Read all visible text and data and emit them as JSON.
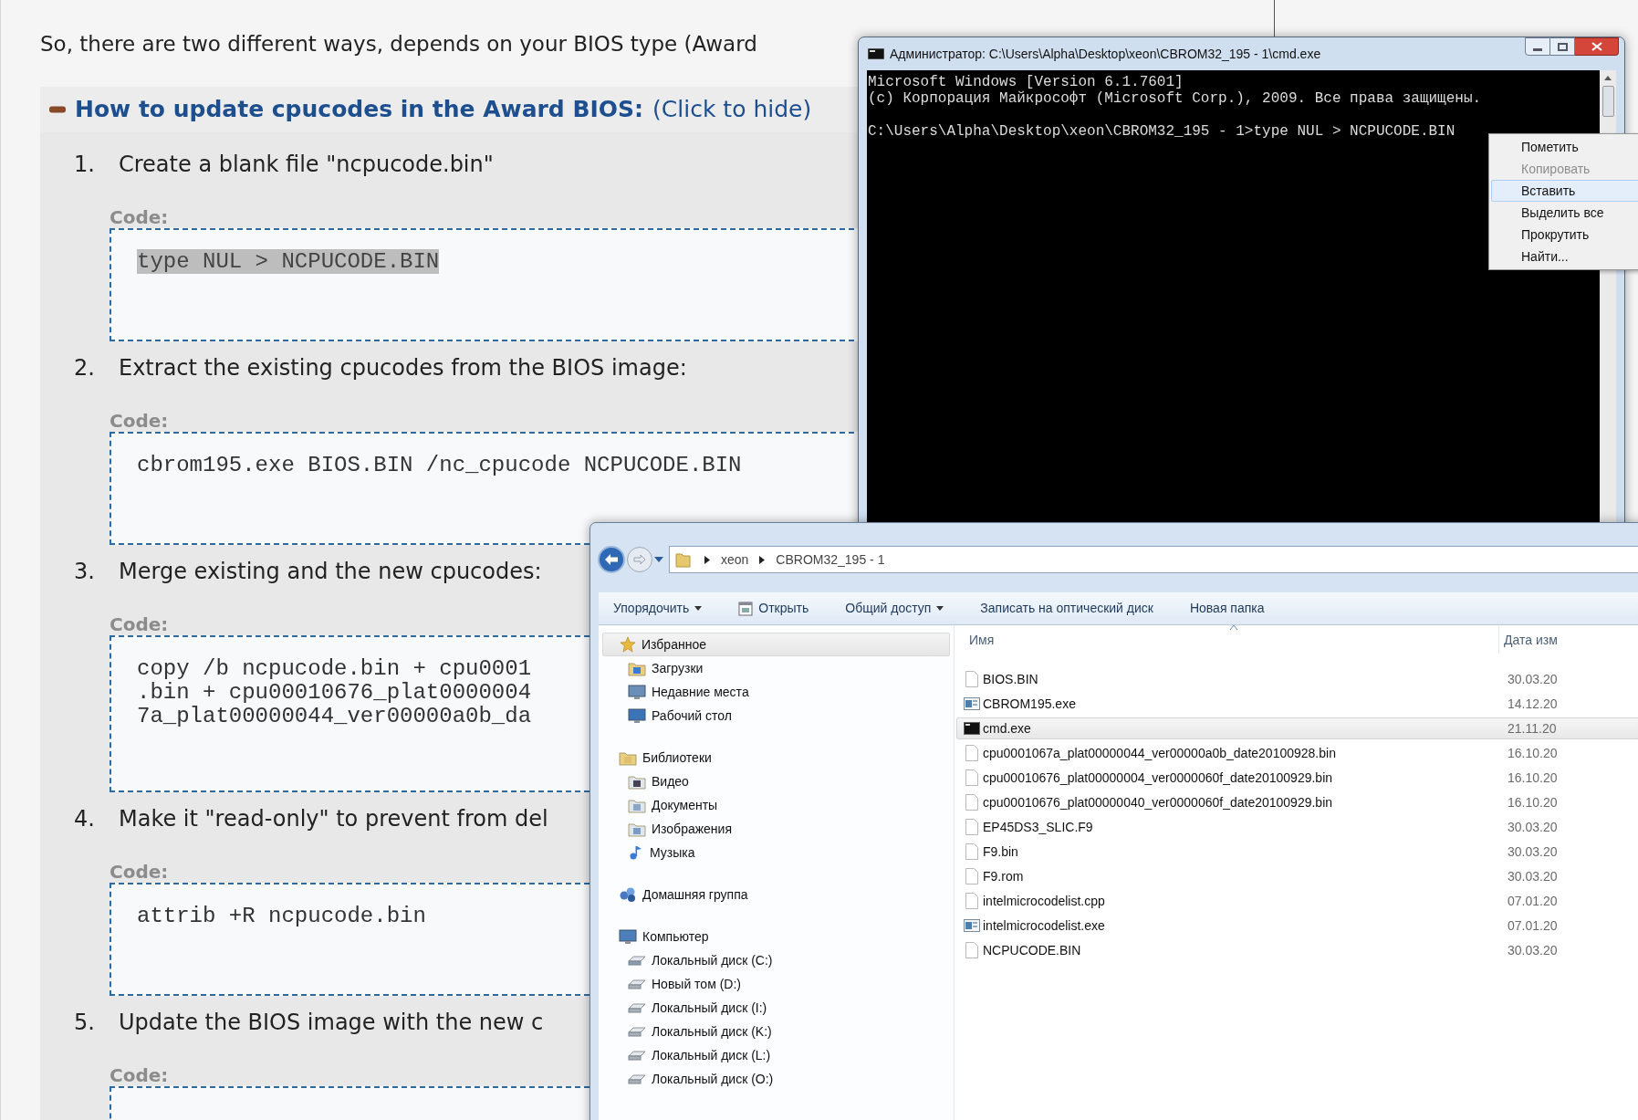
{
  "page": {
    "intro": "So, there are two different ways, depends on your BIOS type (Award",
    "section": {
      "expanded": true,
      "title": "How to update cpucodes in the Award BIOS:",
      "toggle": "(Click to hide)",
      "steps": [
        {
          "number": "1.",
          "text": "Create a blank file \"ncpucode.bin\"",
          "code_label": "Code:",
          "code_lines": [
            "type NUL > NCPUCODE.BIN"
          ],
          "code_selected": true
        },
        {
          "number": "2.",
          "text": "Extract the existing cpucodes from the BIOS image:",
          "code_label": "Code:",
          "code_lines": [
            "cbrom195.exe BIOS.BIN /nc_cpucode NCPUCODE.BIN"
          ]
        },
        {
          "number": "3.",
          "text": "Merge existing and the new cpucodes:",
          "code_label": "Code:",
          "code_lines": [
            "copy /b ncpucode.bin + cpu0001",
            ".bin + cpu00010676_plat0000004",
            "7a_plat00000044_ver00000a0b_da"
          ]
        },
        {
          "number": "4.",
          "text": "Make it \"read-only\" to prevent from del",
          "code_label": "Code:",
          "code_lines": [
            "attrib +R ncpucode.bin"
          ]
        },
        {
          "number": "5.",
          "text": "Update the BIOS image with the new c",
          "code_label": "Code:"
        }
      ]
    }
  },
  "console_window": {
    "title": "Администратор: C:\\Users\\Alpha\\Desktop\\xeon\\CBROM32_195 - 1\\cmd.exe",
    "lines": [
      "Microsoft Windows [Version 6.1.7601]",
      "(c) Корпорация Майкрософт (Microsoft Corp.), 2009. Все права защищены.",
      "C:\\Users\\Alpha\\Desktop\\xeon\\CBROM32_195 - 1>type NUL > NCPUCODE.BIN"
    ],
    "context_menu": [
      {
        "label": "Пометить",
        "disabled": false,
        "selected": false
      },
      {
        "label": "Копировать",
        "disabled": true,
        "selected": false
      },
      {
        "label": "Вставить",
        "disabled": false,
        "selected": true
      },
      {
        "label": "Выделить все",
        "disabled": false,
        "selected": false
      },
      {
        "label": "Прокрутить",
        "disabled": false,
        "selected": false
      },
      {
        "label": "Найти...",
        "disabled": false,
        "selected": false
      }
    ]
  },
  "explorer_window": {
    "breadcrumb": [
      "xeon",
      "CBROM32_195 - 1"
    ],
    "toolbar": [
      {
        "label": "Упорядочить",
        "kind": "menu"
      },
      {
        "label": "Открыть",
        "kind": "open"
      },
      {
        "label": "Общий доступ",
        "kind": "menu"
      },
      {
        "label": "Записать на оптический диск",
        "kind": "plain"
      },
      {
        "label": "Новая папка",
        "kind": "plain"
      }
    ],
    "sidebar": [
      {
        "label": "Избранное",
        "kind": "favorites",
        "selected": true,
        "children": [
          {
            "label": "Загрузки",
            "kind": "downloads",
            "selected": false
          },
          {
            "label": "Недавние места",
            "kind": "recent",
            "selected": false
          },
          {
            "label": "Рабочий стол",
            "kind": "desktop",
            "selected": false
          }
        ]
      },
      {
        "label": "Библиотеки",
        "kind": "libraries",
        "selected": false,
        "children": [
          {
            "label": "Видео",
            "kind": "video",
            "selected": false
          },
          {
            "label": "Документы",
            "kind": "documents",
            "selected": false
          },
          {
            "label": "Изображения",
            "kind": "pictures",
            "selected": false
          },
          {
            "label": "Музыка",
            "kind": "music",
            "selected": false
          }
        ]
      },
      {
        "label": "Домашняя группа",
        "kind": "homegroup",
        "selected": false
      },
      {
        "label": "Компьютер",
        "kind": "computer",
        "selected": false,
        "children": [
          {
            "label": "Локальный диск (C:)",
            "kind": "system_drive",
            "selected": false
          },
          {
            "label": "Новый том (D:)",
            "kind": "drive",
            "selected": false
          },
          {
            "label": "Локальный диск (I:)",
            "kind": "drive",
            "selected": false
          },
          {
            "label": "Локальный диск (K:)",
            "kind": "drive",
            "selected": false
          },
          {
            "label": "Локальный диск (L:)",
            "kind": "drive",
            "selected": false
          },
          {
            "label": "Локальный диск (O:)",
            "kind": "drive",
            "selected": false
          }
        ]
      }
    ],
    "columns": [
      "Имя",
      "Дата изм"
    ],
    "files": [
      {
        "name": "BIOS.BIN",
        "kind": "file",
        "date": "30.03.20",
        "selected": false
      },
      {
        "name": "CBROM195.exe",
        "kind": "app",
        "date": "14.12.20",
        "selected": false
      },
      {
        "name": "cmd.exe",
        "kind": "console",
        "date": "21.11.20",
        "selected": true
      },
      {
        "name": "cpu0001067a_plat00000044_ver00000a0b_date20100928.bin",
        "kind": "file",
        "date": "16.10.20",
        "selected": false
      },
      {
        "name": "cpu00010676_plat00000004_ver0000060f_date20100929.bin",
        "kind": "file",
        "date": "16.10.20",
        "selected": false
      },
      {
        "name": "cpu00010676_plat00000040_ver0000060f_date20100929.bin",
        "kind": "file",
        "date": "16.10.20",
        "selected": false
      },
      {
        "name": "EP45DS3_SLIC.F9",
        "kind": "file",
        "date": "30.03.20",
        "selected": false
      },
      {
        "name": "F9.bin",
        "kind": "file",
        "date": "30.03.20",
        "selected": false
      },
      {
        "name": "F9.rom",
        "kind": "file",
        "date": "30.03.20",
        "selected": false
      },
      {
        "name": "intelmicrocodelist.cpp",
        "kind": "file",
        "date": "07.01.20",
        "selected": false
      },
      {
        "name": "intelmicrocodelist.exe",
        "kind": "app",
        "date": "07.01.20",
        "selected": false
      },
      {
        "name": "NCPUCODE.BIN",
        "kind": "file",
        "date": "30.03.20",
        "selected": false
      }
    ]
  }
}
